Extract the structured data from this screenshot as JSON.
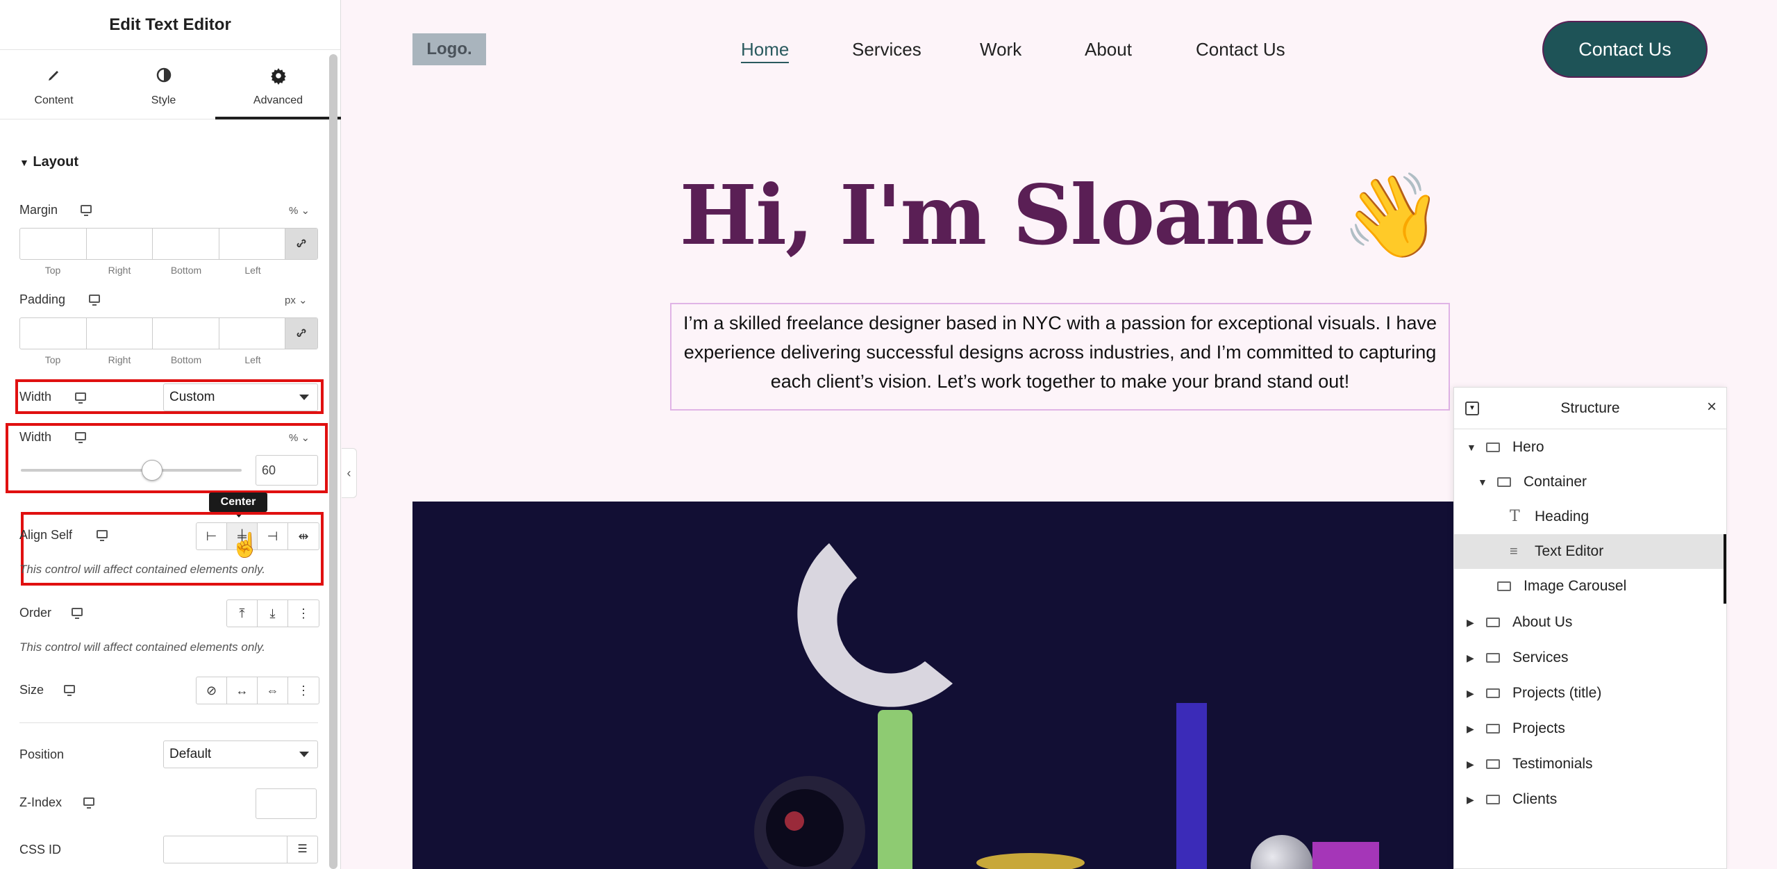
{
  "panel": {
    "title": "Edit Text Editor",
    "tabs": [
      {
        "label": "Content",
        "icon": "pencil-icon"
      },
      {
        "label": "Style",
        "icon": "contrast-icon"
      },
      {
        "label": "Advanced",
        "icon": "gear-icon",
        "active": true
      }
    ],
    "layout_section": "Layout",
    "margin": {
      "label": "Margin",
      "unit": "%",
      "sides": [
        "Top",
        "Right",
        "Bottom",
        "Left"
      ]
    },
    "padding": {
      "label": "Padding",
      "unit": "px",
      "sides": [
        "Top",
        "Right",
        "Bottom",
        "Left"
      ]
    },
    "width_select": {
      "label": "Width",
      "value": "Custom"
    },
    "width_slider": {
      "label": "Width",
      "unit": "%",
      "value": "60",
      "fraction": 0.6
    },
    "align_self": {
      "label": "Align Self",
      "tooltip": "Center",
      "note": "This control will affect contained elements only."
    },
    "order": {
      "label": "Order",
      "note": "This control will affect contained elements only."
    },
    "size": {
      "label": "Size"
    },
    "position": {
      "label": "Position",
      "value": "Default"
    },
    "z_index": {
      "label": "Z-Index"
    },
    "css_id": {
      "label": "CSS ID"
    }
  },
  "site": {
    "logo": "Logo.",
    "nav": [
      "Home",
      "Services",
      "Work",
      "About",
      "Contact Us"
    ],
    "cta": "Contact Us",
    "hero_title": "Hi, I'm Sloane 👋",
    "hero_text": "I’m a skilled freelance designer based in NYC with a passion for exceptional visuals. I have experience delivering successful designs across industries, and I’m committed to capturing each client’s vision. Let’s work together to make your brand stand out!"
  },
  "structure": {
    "title": "Structure",
    "items": [
      {
        "label": "Hero",
        "level": 0,
        "expanded": true
      },
      {
        "label": "Container",
        "level": 1,
        "expanded": true
      },
      {
        "label": "Heading",
        "level": 2
      },
      {
        "label": "Text Editor",
        "level": 2,
        "selected": true
      },
      {
        "label": "Image Carousel",
        "level": 1
      },
      {
        "label": "About Us",
        "level": 0
      },
      {
        "label": "Services",
        "level": 0
      },
      {
        "label": "Projects (title)",
        "level": 0
      },
      {
        "label": "Projects",
        "level": 0
      },
      {
        "label": "Testimonials",
        "level": 0
      },
      {
        "label": "Clients",
        "level": 0
      }
    ]
  },
  "colors": {
    "accent": "#1e5357",
    "heading": "#5a1f55",
    "highlight": "#e01010"
  }
}
